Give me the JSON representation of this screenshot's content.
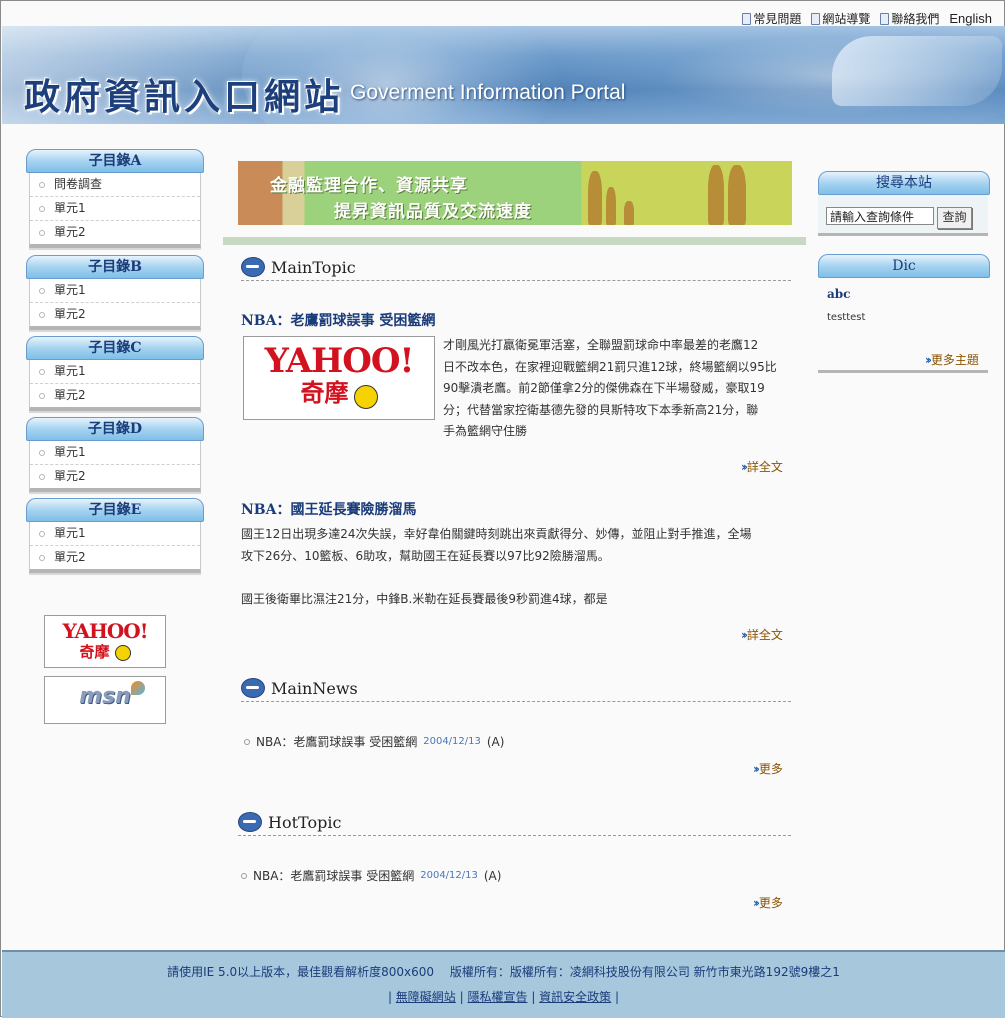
{
  "top_links": {
    "faq": "常見問題",
    "sitemap": "網站導覽",
    "contact": "聯絡我們",
    "english": "English"
  },
  "banner": {
    "title_cn": "政府資訊入口網站",
    "title_en": "Goverment Information Portal"
  },
  "left_menus": [
    {
      "title": "子目錄A",
      "items": [
        "問卷調查",
        "單元1",
        "單元2"
      ]
    },
    {
      "title": "子目錄B",
      "items": [
        "單元1",
        "單元2"
      ]
    },
    {
      "title": "子目錄C",
      "items": [
        "單元1",
        "單元2"
      ]
    },
    {
      "title": "子目錄D",
      "items": [
        "單元1",
        "單元2"
      ]
    },
    {
      "title": "子目錄E",
      "items": [
        "單元1",
        "單元2"
      ]
    }
  ],
  "left_logos": {
    "yahoo_text": "YAHOO!",
    "yahoo_sub": "奇摩",
    "msn_text": "msn"
  },
  "promo": {
    "line1": "金融監理合作、資源共享",
    "line2": "提昇資訊品質及交流速度"
  },
  "main_topic": {
    "heading": "MainTopic",
    "articles": [
      {
        "title": "NBA：老鷹罰球誤事 受困籃網",
        "image_text": "YAHOO!",
        "image_sub": "奇摩",
        "lines": [
          "才剛風光打贏衛冕軍活塞，全聯盟罰球命中率最差的老鷹12",
          "日不改本色，在家裡迎戰籃網21罰只進12球，終場籃網以95比",
          "90擊潰老鷹。前2節僅拿2分的傑佛森在下半場發威，豪取19",
          "分；代替當家控衛基德先發的貝斯特攻下本季新高21分，聯",
          "手為籃網守住勝"
        ],
        "more": "詳全文"
      },
      {
        "title": "NBA：國王延長賽險勝溜馬",
        "lines": [
          "國王12日出現多達24次失誤，幸好韋伯關鍵時刻跳出來貢獻得分、妙傳，並阻止對手推進，全場",
          "攻下26分、10籃板、6助攻，幫助國王在延長賽以97比92險勝溜馬。",
          "",
          "國王後衛畢比濕注21分，中鋒B.米勒在延長賽最後9秒罰進4球，都是"
        ],
        "more": "詳全文"
      }
    ]
  },
  "main_news": {
    "heading": "MainNews",
    "items": [
      {
        "title": "NBA：老鷹罰球誤事 受困籃網",
        "date": "2004/12/13",
        "tag": "(A)"
      }
    ],
    "more": "更多"
  },
  "hot_topic": {
    "heading": "HotTopic",
    "items": [
      {
        "title": "NBA：老鷹罰球誤事 受困籃網",
        "date": "2004/12/13",
        "tag": "(A)"
      }
    ],
    "more": "更多"
  },
  "search": {
    "heading": "搜尋本站",
    "input_value": "請輸入查詢條件",
    "button": "查詢"
  },
  "dic": {
    "heading": "Dic",
    "term": "abc",
    "desc": "testtest",
    "more": "更多主題"
  },
  "footer": {
    "line1": "請使用IE 5.0以上版本，最佳觀看解析度800x600　 版權所有：版權所有：凌網科技股份有限公司 新竹市東光路192號9樓之1",
    "links": [
      "無障礙網站",
      "隱私權宣告",
      "資訊安全政策"
    ]
  },
  "colors": {
    "menu_header": "#a6d3f0",
    "title_blue": "#1b3c7a",
    "footer_bg": "#a6c7dc",
    "more_arrow": "#1c5fb0"
  }
}
